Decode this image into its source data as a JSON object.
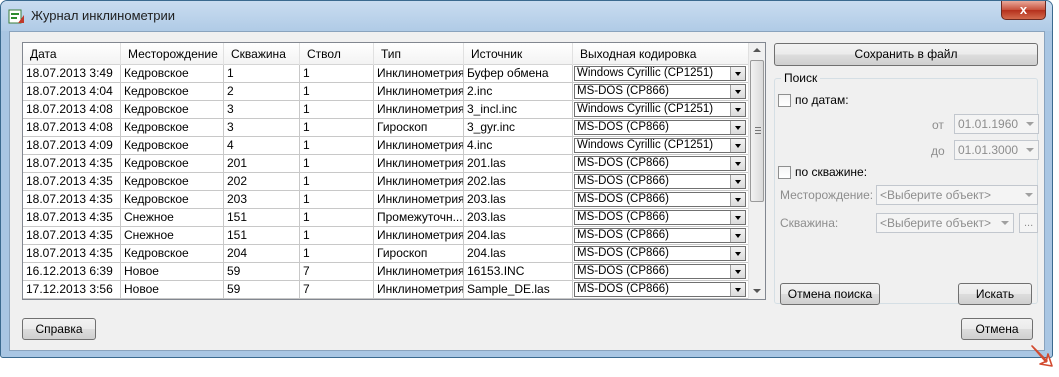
{
  "window": {
    "title": "Журнал инклинометрии",
    "close_label": "x"
  },
  "grid": {
    "columns": [
      "Дата",
      "Месторождение",
      "Скважина",
      "Ствол",
      "Тип",
      "Источник",
      "Выходная кодировка"
    ],
    "rows": [
      [
        "18.07.2013 3:49",
        "Кедровское",
        "1",
        "1",
        "Инклинометрия",
        "Буфер обмена",
        "Windows Cyrillic (CP1251)"
      ],
      [
        "18.07.2013 4:04",
        "Кедровское",
        "2",
        "1",
        "Инклинометрия",
        "2.inc",
        "MS-DOS (CP866)"
      ],
      [
        "18.07.2013 4:08",
        "Кедровское",
        "3",
        "1",
        "Инклинометрия",
        "3_incl.inc",
        "Windows Cyrillic (CP1251)"
      ],
      [
        "18.07.2013 4:08",
        "Кедровское",
        "3",
        "1",
        "Гироскоп",
        "3_gyr.inc",
        "MS-DOS (CP866)"
      ],
      [
        "18.07.2013 4:09",
        "Кедровское",
        "4",
        "1",
        "Инклинометрия",
        "4.inc",
        "Windows Cyrillic (CP1251)"
      ],
      [
        "18.07.2013 4:35",
        "Кедровское",
        "201",
        "1",
        "Инклинометрия",
        "201.las",
        "MS-DOS (CP866)"
      ],
      [
        "18.07.2013 4:35",
        "Кедровское",
        "202",
        "1",
        "Инклинометрия",
        "202.las",
        "MS-DOS (CP866)"
      ],
      [
        "18.07.2013 4:35",
        "Кедровское",
        "203",
        "1",
        "Инклинометрия",
        "203.las",
        "MS-DOS (CP866)"
      ],
      [
        "18.07.2013 4:35",
        "Снежное",
        "151",
        "1",
        "Промежуточн...",
        "203.las",
        "MS-DOS (CP866)"
      ],
      [
        "18.07.2013 4:35",
        "Снежное",
        "151",
        "1",
        "Инклинометрия",
        "204.las",
        "MS-DOS (CP866)"
      ],
      [
        "18.07.2013 4:35",
        "Кедровское",
        "204",
        "1",
        "Гироскоп",
        "204.las",
        "MS-DOS (CP866)"
      ],
      [
        "16.12.2013 6:39",
        "Новое",
        "59",
        "7",
        "Инклинометрия",
        "16153.INC",
        "MS-DOS (CP866)"
      ],
      [
        "17.12.2013 3:56",
        "Новое",
        "59",
        "7",
        "Инклинометрия",
        "Sample_DE.las",
        "MS-DOS (CP866)"
      ]
    ]
  },
  "panel": {
    "save_label": "Сохранить в файл",
    "search_title": "Поиск",
    "by_dates_label": "по датам:",
    "from_label": "от",
    "from_value": "01.01.1960",
    "to_label": "до",
    "to_value": "01.01.3000",
    "by_well_label": "по скважине:",
    "field_label": "Месторождение:",
    "field_value": "<Выберите объект>",
    "well_label": "Скважина:",
    "well_value": "<Выберите объект>",
    "browse_label": "...",
    "cancel_search_label": "Отмена поиска",
    "search_label": "Искать"
  },
  "footer": {
    "help_label": "Справка",
    "cancel_label": "Отмена"
  }
}
